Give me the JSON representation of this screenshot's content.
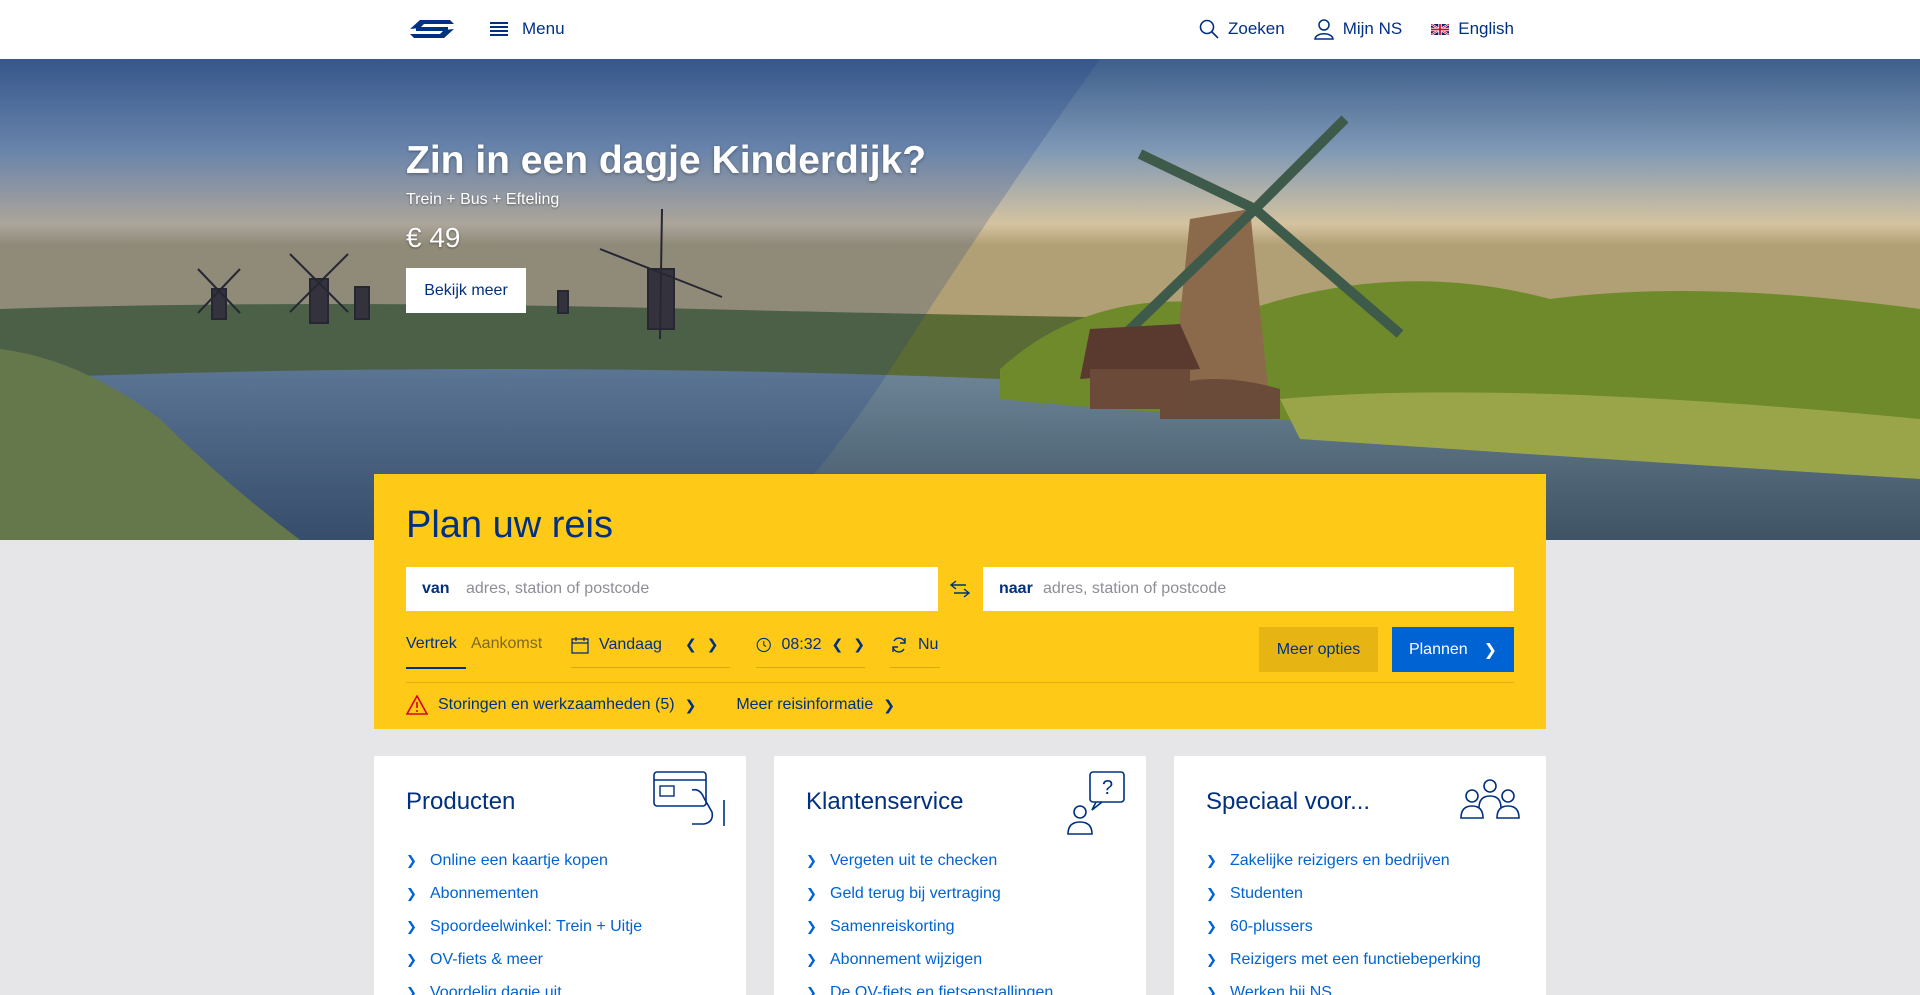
{
  "header": {
    "logo_icon": "ns-logo-icon",
    "menu_label": "Menu",
    "search_label": "Zoeken",
    "account_label": "Mijn NS",
    "language_label": "English"
  },
  "hero": {
    "title": "Zin in een dagje Kinderdijk?",
    "subtitle": "Trein + Bus + Efteling",
    "price": "€ 49",
    "button_label": "Bekijk meer"
  },
  "planner": {
    "title": "Plan uw reis",
    "from_label": "van",
    "from_placeholder": "adres, station of postcode",
    "to_label": "naar",
    "to_placeholder": "adres, station of postcode",
    "tab_departure": "Vertrek",
    "tab_arrival": "Aankomst",
    "date_value": "Vandaag",
    "time_value": "08:32",
    "now_label": "Nu",
    "more_options_label": "Meer opties",
    "plan_label": "Plannen",
    "disruptions_label": "Storingen en werkzaamheden (5)",
    "more_info_label": "Meer reisinformatie",
    "colors": {
      "yellow": "#ffc917",
      "blue": "#003082",
      "button_blue": "#0063d3"
    }
  },
  "cards": [
    {
      "title": "Producten",
      "icon": "card-payment-icon",
      "links": [
        "Online een kaartje kopen",
        "Abonnementen",
        "Spoordeelwinkel: Trein + Uitje",
        "OV-fiets & meer",
        "Voordelig dagje uit"
      ]
    },
    {
      "title": "Klantenservice",
      "icon": "customer-question-icon",
      "links": [
        "Vergeten uit te checken",
        "Geld terug bij vertraging",
        "Samenreiskorting",
        "Abonnement wijzigen",
        "De OV-fiets en fietsenstallingen"
      ]
    },
    {
      "title": "Speciaal voor...",
      "icon": "group-people-icon",
      "links": [
        "Zakelijke reizigers en bedrijven",
        "Studenten",
        "60-plussers",
        "Reizigers met een functiebeperking",
        "Werken bij NS"
      ]
    }
  ]
}
